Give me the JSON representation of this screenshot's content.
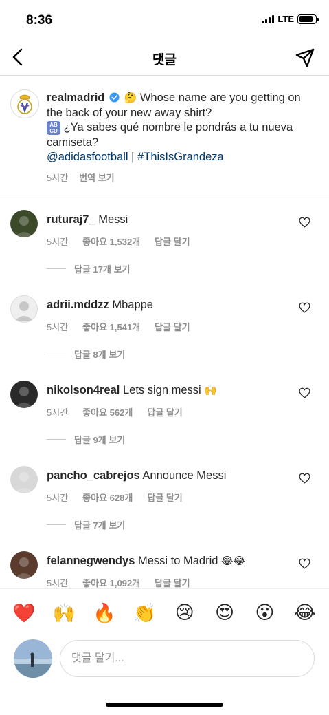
{
  "status_bar": {
    "time": "8:36",
    "network": "LTE",
    "battery_level": 0.85
  },
  "nav": {
    "title": "댓글",
    "back_icon": "chevron-left-icon",
    "send_icon": "paper-plane-icon"
  },
  "caption": {
    "username": "realmadrid",
    "verified_icon": "verified-badge-icon",
    "thinking_emoji": "🤔",
    "text_en": "Whose name are you getting on the back of your new away shirt?",
    "abcd_emoji_top": "AB",
    "abcd_emoji_bottom": "CD",
    "text_es": "¿Ya sabes qué nombre le pondrás a tu nueva camiseta?",
    "mention": "@adidasfootball",
    "separator": "|",
    "hashtag": "#ThisIsGrandeza",
    "time": "5시간",
    "translate": "번역 보기"
  },
  "comments": [
    {
      "username": "ruturaj7_",
      "text": "Messi",
      "emoji": "",
      "time": "5시간",
      "likes": "좋아요 1,532개",
      "reply": "답글 달기",
      "view_replies": "답글 17개 보기",
      "avatar_color": "#3d4a2a"
    },
    {
      "username": "adrii.mddzz",
      "text": "Mbappe",
      "emoji": "",
      "time": "5시간",
      "likes": "좋아요 1,541개",
      "reply": "답글 달기",
      "view_replies": "답글 8개 보기",
      "avatar_color": "#e6e6e6"
    },
    {
      "username": "nikolson4real",
      "text": "Lets sign messi",
      "emoji": "🙌",
      "time": "5시간",
      "likes": "좋아요 562개",
      "reply": "답글 달기",
      "view_replies": "답글 9개 보기",
      "avatar_color": "#2a2a2a"
    },
    {
      "username": "pancho_cabrejos",
      "text": "Announce Messi",
      "emoji": "",
      "time": "5시간",
      "likes": "좋아요 628개",
      "reply": "답글 달기",
      "view_replies": "답글 7개 보기",
      "avatar_color": "#d8d8d8"
    },
    {
      "username": "felannegwendys",
      "text": "Messi to Madrid",
      "emoji": "😂😂",
      "time": "5시간",
      "likes": "좋아요 1,092개",
      "reply": "답글 달기",
      "view_replies": "",
      "avatar_color": "#5a3b2e"
    }
  ],
  "emoji_bar": [
    "❤️",
    "🙌",
    "🔥",
    "👏",
    "😢",
    "😍",
    "😮",
    "😂"
  ],
  "input": {
    "placeholder": "댓글 달기..."
  },
  "colors": {
    "link": "#00376b",
    "meta": "#8e8e8e",
    "text": "#262626",
    "verified": "#3897f0"
  }
}
